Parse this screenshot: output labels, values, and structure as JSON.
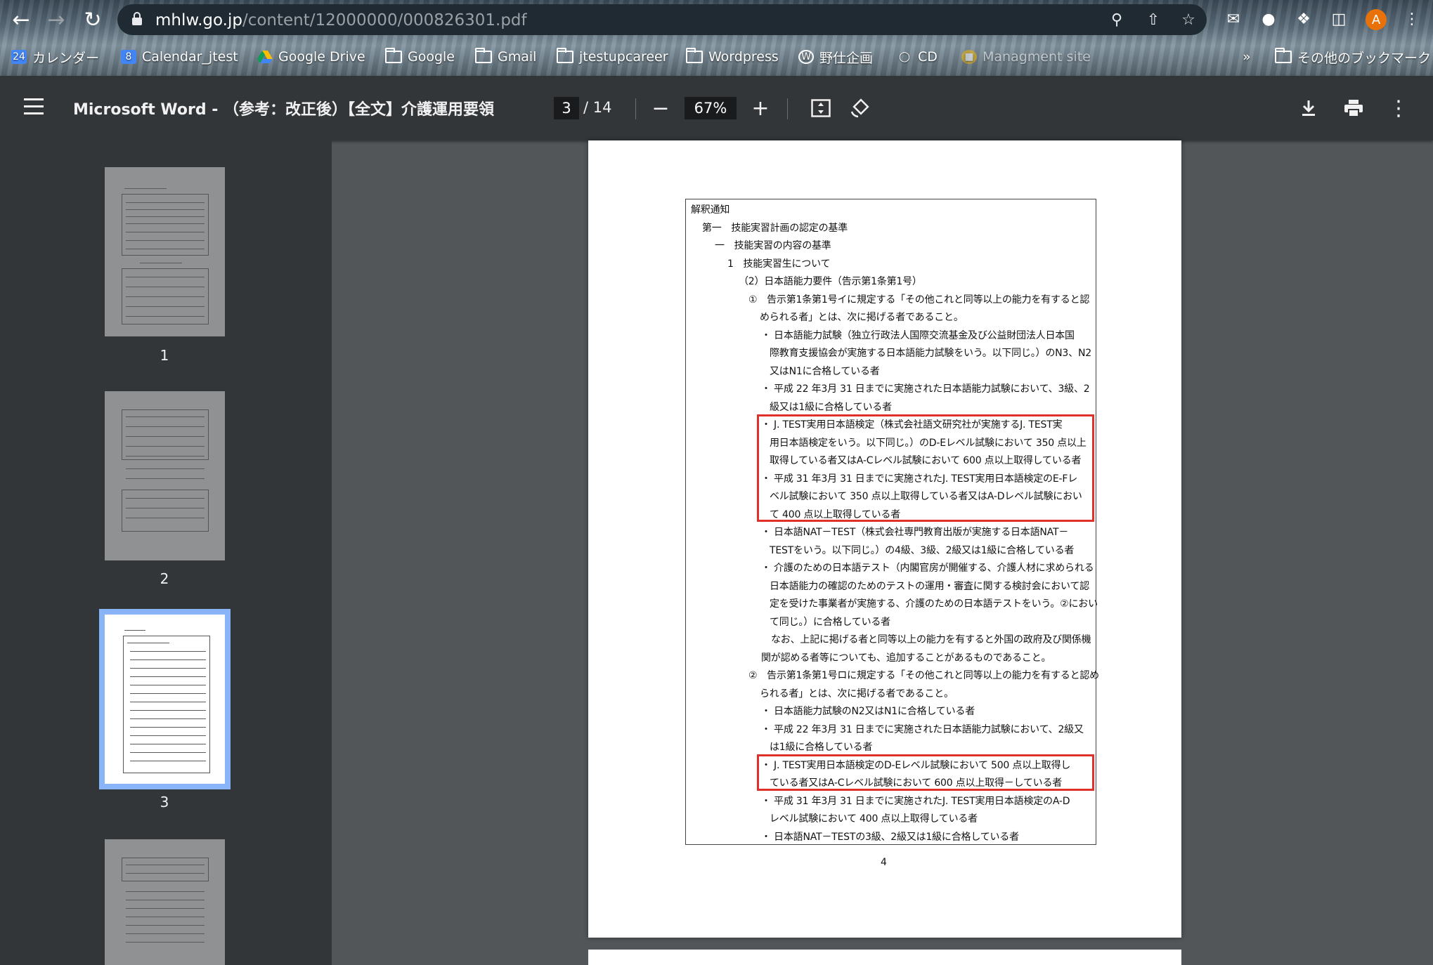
{
  "browser": {
    "url_host": "mhlw.go.jp",
    "url_path": "/content/12000000/000826301.pdf",
    "avatar_letter": "A",
    "bookmarks": [
      {
        "label": "カレンダー",
        "icon": "calendar-icon"
      },
      {
        "label": "Calendar_jtest",
        "icon": "calendar-icon"
      },
      {
        "label": "Google Drive",
        "icon": "google-drive-icon"
      },
      {
        "label": "Google",
        "icon": "folder-icon"
      },
      {
        "label": "Gmail",
        "icon": "folder-icon"
      },
      {
        "label": "jtestupcareer",
        "icon": "folder-icon"
      },
      {
        "label": "Wordpress",
        "icon": "folder-icon"
      },
      {
        "label": "野仕企画",
        "icon": "wordpress-icon"
      },
      {
        "label": "CD",
        "icon": "globe-icon"
      },
      {
        "label": "Managment site",
        "icon": "box-icon"
      },
      {
        "label": "»",
        "icon": ""
      },
      {
        "label": "その他のブックマーク",
        "icon": "folder-icon"
      }
    ]
  },
  "pdf_toolbar": {
    "title": "Microsoft Word - （参考：改正後）【全文】介護運用要領",
    "current_page": "3",
    "total_pages": "/ 14",
    "zoom": "67%"
  },
  "thumbnails": [
    {
      "number": "1",
      "selected": false
    },
    {
      "number": "2",
      "selected": false
    },
    {
      "number": "3",
      "selected": true
    },
    {
      "number": "",
      "selected": false
    }
  ],
  "document": {
    "page_number": "4",
    "lines": [
      "解釈通知",
      "第一　技能実習計画の認定の基準",
      "一　技能実習の内容の基準",
      "1　技能実習生について",
      "（2）日本語能力要件（告示第1条第1号）",
      "①　告示第1条第1号イに規定する「その他これと同等以上の能力を有すると認",
      "められる者」とは、次に掲げる者であること。",
      "・ 日本語能力試験（独立行政法人国際交流基金及び公益財団法人日本国",
      "際教育支援協会が実施する日本語能力試験をいう。以下同じ。）のN3、N2",
      "又はN1に合格している者",
      "・ 平成 22 年3月 31 日までに実施された日本語能力試験において、3級、2",
      "級又は1級に合格している者",
      "・ J. TEST実用日本語検定（株式会社語文研究社が実施するJ. TEST実",
      "用日本語検定をいう。以下同じ。）のD-Eレベル試験において 350 点以上",
      "取得している者又はA-Cレベル試験において 600 点以上取得している者",
      "・ 平成 31 年3月 31 日までに実施されたJ. TEST実用日本語検定のE-Fレ",
      "ベル試験において 350 点以上取得している者又はA-Dレベル試験におい",
      "て 400 点以上取得している者",
      "・ 日本語NAT－TEST（株式会社専門教育出版が実施する日本語NAT－",
      "TESTをいう。以下同じ。）の4級、3級、2級又は1級に合格している者",
      "・ 介護のための日本語テスト（内閣官房が開催する、介護人材に求められる",
      "日本語能力の確認のためのテストの運用・審査に関する検討会において認",
      "定を受けた事業者が実施する、介護のための日本語テストをいう。②におい",
      "て同じ。）に合格している者",
      "なお、上記に掲げる者と同等以上の能力を有すると外国の政府及び関係機",
      "関が認める者等についても、追加することがあるものであること。",
      "②　告示第1条第1号ロに規定する「その他これと同等以上の能力を有すると認め",
      "られる者」とは、次に掲げる者であること。",
      "・ 日本語能力試験のN2又はN1に合格している者",
      "・ 平成 22 年3月 31 日までに実施された日本語能力試験において、2級又",
      "は1級に合格している者",
      "・ J. TEST実用日本語検定のD-Eレベル試験において 500 点以上取得し",
      "ている者又はA-Cレベル試験において 600 点以上取得－している者",
      "・ 平成 31 年3月 31 日までに実施されたJ. TEST実用日本語検定のA-D",
      "レベル試験において 400 点以上取得している者",
      "・ 日本語NAT－TESTの3級、2級又は1級に合格している者"
    ]
  },
  "colors": {
    "highlight_box": "#e0302a",
    "toolbar_bg": "#323639",
    "viewer_bg": "#525659",
    "selected_thumb_outline": "#8ab4f8"
  }
}
